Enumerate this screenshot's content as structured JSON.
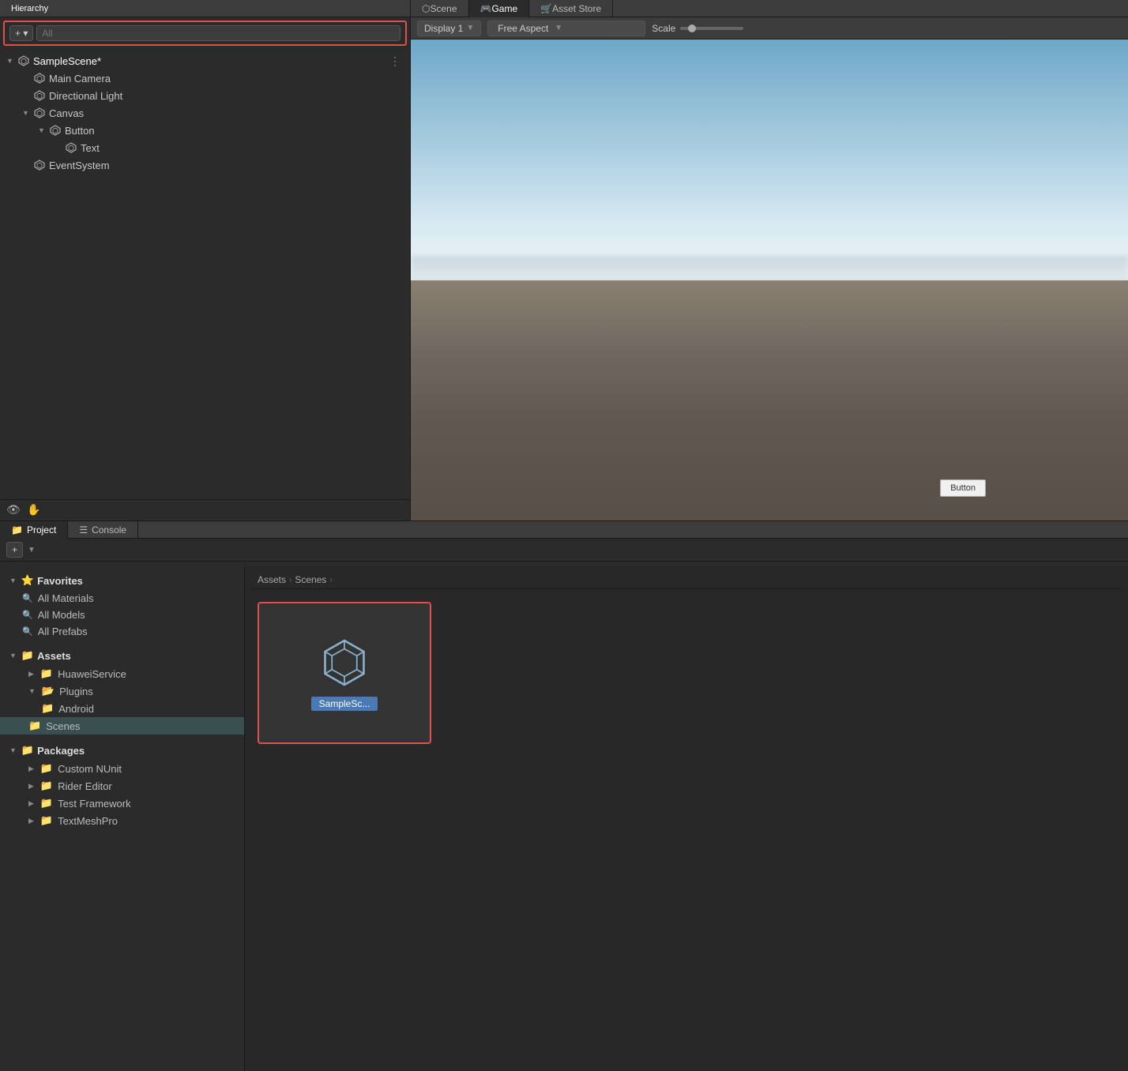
{
  "hierarchy": {
    "panel_title": "Hierarchy",
    "search_placeholder": "All",
    "add_btn": "+ ▾",
    "scene_name": "SampleScene*",
    "items": [
      {
        "id": "main-camera",
        "label": "Main Camera",
        "indent": 1,
        "has_arrow": false,
        "arrow": ""
      },
      {
        "id": "directional-light",
        "label": "Directional Light",
        "indent": 1,
        "has_arrow": false,
        "arrow": ""
      },
      {
        "id": "canvas",
        "label": "Canvas",
        "indent": 1,
        "has_arrow": true,
        "arrow": "▼"
      },
      {
        "id": "button",
        "label": "Button",
        "indent": 2,
        "has_arrow": true,
        "arrow": "▼"
      },
      {
        "id": "text",
        "label": "Text",
        "indent": 3,
        "has_arrow": false,
        "arrow": ""
      },
      {
        "id": "eventsystem",
        "label": "EventSystem",
        "indent": 1,
        "has_arrow": false,
        "arrow": ""
      }
    ]
  },
  "game_view": {
    "tabs": [
      "Scene",
      "Game",
      "Asset Store"
    ],
    "active_tab": "Game",
    "display_label": "Display 1",
    "aspect_label": "Free Aspect",
    "scale_label": "Scale",
    "button_label": "Button"
  },
  "bottom": {
    "tabs": [
      "Project",
      "Console"
    ],
    "active_tab": "Project",
    "project_icon": "📁",
    "console_icon": "☰",
    "add_btn": "+",
    "breadcrumb": [
      "Assets",
      "Scenes"
    ],
    "favorites": {
      "label": "Favorites",
      "items": [
        "All Materials",
        "All Models",
        "All Prefabs"
      ]
    },
    "assets": {
      "label": "Assets",
      "items": [
        {
          "label": "HuaweiService",
          "indent": 1,
          "arrow": "▶"
        },
        {
          "label": "Plugins",
          "indent": 1,
          "arrow": "▼"
        },
        {
          "label": "Android",
          "indent": 2,
          "arrow": ""
        },
        {
          "label": "Scenes",
          "indent": 1,
          "arrow": "",
          "selected": true
        }
      ]
    },
    "packages": {
      "label": "Packages",
      "items": [
        {
          "label": "Custom NUnit",
          "indent": 1,
          "arrow": "▶"
        },
        {
          "label": "Rider Editor",
          "indent": 1,
          "arrow": "▶"
        },
        {
          "label": "Test Framework",
          "indent": 1,
          "arrow": "▶"
        },
        {
          "label": "TextMeshPro",
          "indent": 1,
          "arrow": "▶"
        }
      ]
    },
    "scene_asset": {
      "label": "SampleSc..."
    }
  },
  "colors": {
    "selected_blue": "#2c5f8a",
    "highlight_red": "#e05050",
    "folder_yellow": "#c8a040",
    "asset_blue": "#4a7ab5",
    "bg_dark": "#2b2b2b",
    "bg_medium": "#3c3c3c"
  }
}
